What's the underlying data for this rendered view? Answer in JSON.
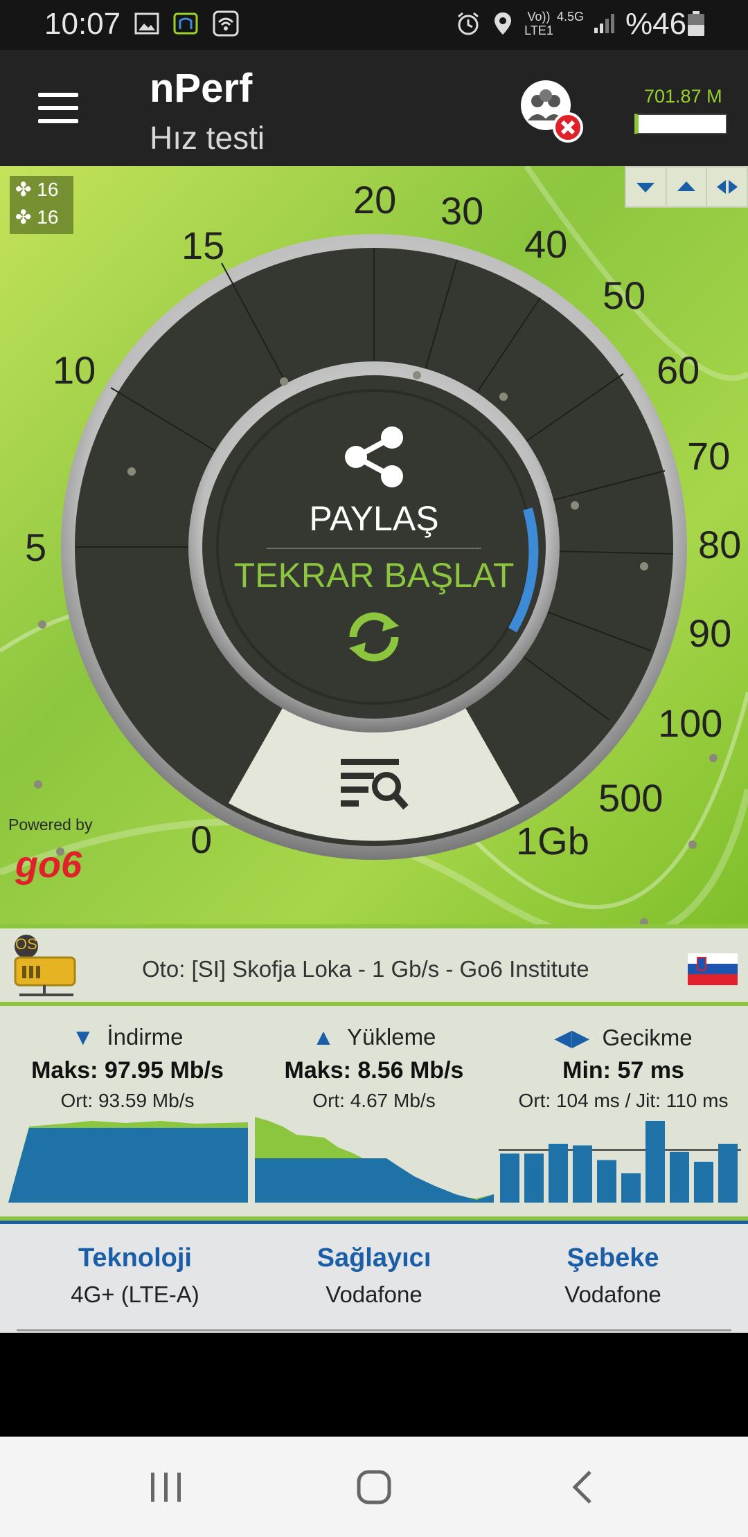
{
  "status_bar": {
    "time": "10:07",
    "network_label": "Vo)) LTE1",
    "network_type": "4.5G",
    "battery": "%46",
    "icons": [
      "image-icon",
      "nperf-notification-icon",
      "wifi-icon",
      "alarm-icon",
      "location-icon",
      "signal-icon",
      "battery-icon"
    ]
  },
  "app_bar": {
    "title": "nPerf",
    "subtitle": "Hız testi",
    "data_quota": "701.87 M"
  },
  "speedometer": {
    "connections": [
      "16",
      "16"
    ],
    "scale_labels": [
      "0",
      "5",
      "10",
      "15",
      "20",
      "30",
      "40",
      "50",
      "60",
      "70",
      "80",
      "90",
      "100",
      "500",
      "1Gb"
    ],
    "share_label": "PAYLAŞ",
    "restart_label": "TEKRAR BAŞLAT",
    "powered_by": "Powered by",
    "sponsor": "go6",
    "accent": "#8cc63f",
    "needle_color": "#3d8bd6"
  },
  "server": {
    "badge": "OS",
    "text": "Oto: [SI] Skofja Loka - 1 Gb/s - Go6 Institute"
  },
  "results": {
    "download": {
      "label": "İndirme",
      "max": "Maks: 97.95 Mb/s",
      "avg": "Ort: 93.59 Mb/s"
    },
    "upload": {
      "label": "Yükleme",
      "max": "Maks: 8.56 Mb/s",
      "avg": "Ort: 4.67 Mb/s"
    },
    "latency": {
      "label": "Gecikme",
      "min": "Min: 57 ms",
      "avg": "Ort: 104 ms / Jit: 110 ms"
    },
    "latency_bars": [
      0.6,
      0.6,
      0.72,
      0.7,
      0.52,
      0.36,
      1.0,
      0.62,
      0.5,
      0.72
    ]
  },
  "info": {
    "technology": {
      "label": "Teknoloji",
      "value": "4G+ (LTE-A)"
    },
    "provider": {
      "label": "Sağlayıcı",
      "value": "Vodafone"
    },
    "network": {
      "label": "Şebeke",
      "value": "Vodafone"
    }
  },
  "colors": {
    "brand_blue": "#1a5ea8",
    "chart_blue": "#1f72a8",
    "green": "#8cc63f"
  }
}
